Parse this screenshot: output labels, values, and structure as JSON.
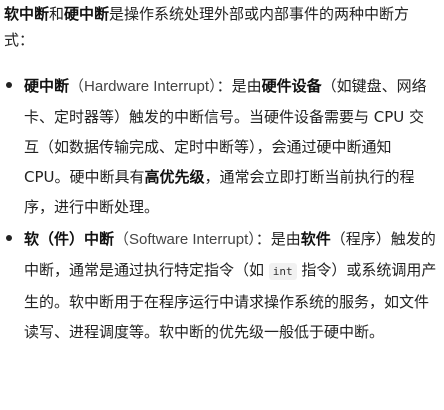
{
  "intro": {
    "soft_interrupt": "软中断",
    "and": "和",
    "hard_interrupt": "硬中断",
    "rest": "是操作系统处理外部或内部事件的两种中断方式："
  },
  "bullets": [
    {
      "term": "硬中断",
      "paren_en": "（Hardware Interrupt）",
      "text1": "：是由",
      "bold1": "硬件设备",
      "text2": "（如键盘、网络卡、定时器等）触发的中断信号。当硬件设备需要与 CPU 交互（如数据传输完成、定时中断等），会通过硬中断通知 CPU。硬中断具有",
      "bold2": "高优先级",
      "text3": "，通常会立即打断当前执行的程序，进行中断处理。"
    },
    {
      "term": "软（件）中断",
      "paren_en": "（Software Interrupt）",
      "text1": "：是由",
      "bold1": "软件",
      "text2": "（程序）触发的中断，通常是通过执行特定指令（如 ",
      "code": "int",
      "text3": " 指令）或系统调用产生的。软中断用于在程序运行中请求操作系统的服务，如文件读写、进程调度等。软中断的优先级一般低于硬中断。"
    }
  ]
}
